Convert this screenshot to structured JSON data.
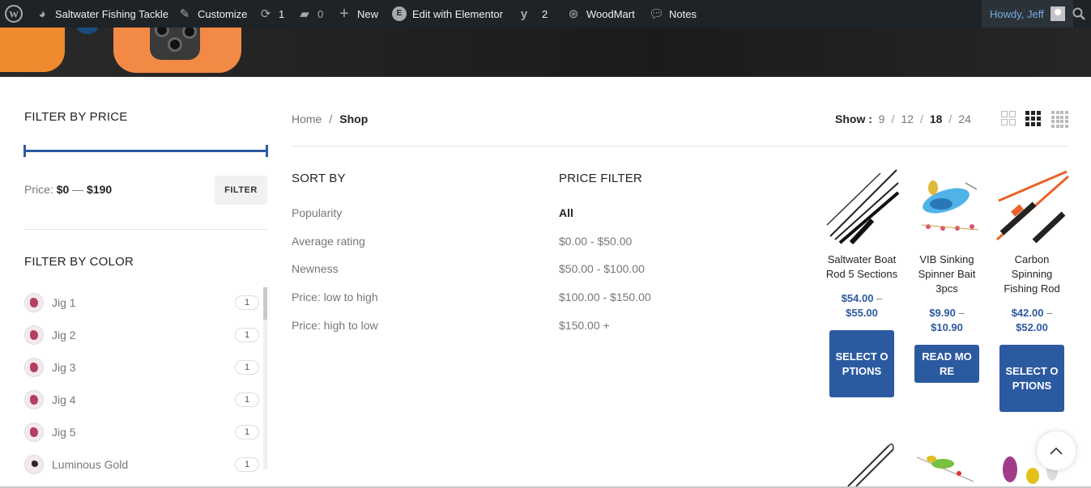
{
  "adminbar": {
    "site_name": "Saltwater Fishing Tackle",
    "customize": "Customize",
    "updates_count": "1",
    "comments_count": "0",
    "new_label": "New",
    "elementor": "Edit with Elementor",
    "yoast_count": "2",
    "woodmart": "WoodMart",
    "notes": "Notes",
    "howdy": "Howdy, Jeff"
  },
  "sidebar": {
    "price_title": "FILTER BY PRICE",
    "price_label": "Price:",
    "price_min": "$0",
    "price_dash": "—",
    "price_max": "$190",
    "filter_button": "FILTER",
    "color_title": "FILTER BY COLOR",
    "colors": [
      {
        "label": "Jig 1",
        "count": "1"
      },
      {
        "label": "Jig 2",
        "count": "1"
      },
      {
        "label": "Jig 3",
        "count": "1"
      },
      {
        "label": "Jig 4",
        "count": "1"
      },
      {
        "label": "Jig 5",
        "count": "1"
      },
      {
        "label": "Luminous Gold",
        "count": "1"
      }
    ]
  },
  "breadcrumb": {
    "home": "Home",
    "sep": "/",
    "current": "Shop"
  },
  "show": {
    "label": "Show :",
    "options": [
      "9",
      "12",
      "18",
      "24"
    ],
    "selected": "18",
    "sep": "/"
  },
  "sort": {
    "title": "SORT BY",
    "options": [
      "Popularity",
      "Average rating",
      "Newness",
      "Price: low to high",
      "Price: high to low"
    ]
  },
  "price_filter": {
    "title": "PRICE FILTER",
    "options": [
      "All",
      "$0.00 - $50.00",
      "$50.00 - $100.00",
      "$100.00 - $150.00",
      "$150.00 +"
    ],
    "selected": "All"
  },
  "products": [
    {
      "name": "Saltwater Boat Rod 5 Sections",
      "price_low": "$54.00",
      "dash": "–",
      "price_high": "$55.00",
      "button": "SELECT OPTIONS"
    },
    {
      "name": "VIB Sinking Spinner Bait 3pcs",
      "price_low": "$9.90",
      "dash": "–",
      "price_high": "$10.90",
      "button": "READ MORE"
    },
    {
      "name": "Carbon Spinning Fishing Rod",
      "price_low": "$42.00",
      "dash": "–",
      "price_high": "$52.00",
      "button": "SELECT OPTIONS"
    }
  ],
  "colors": {
    "accent": "#2c5aa0",
    "adminbar": "#1d2327",
    "hero_orange": "#f28a45"
  }
}
